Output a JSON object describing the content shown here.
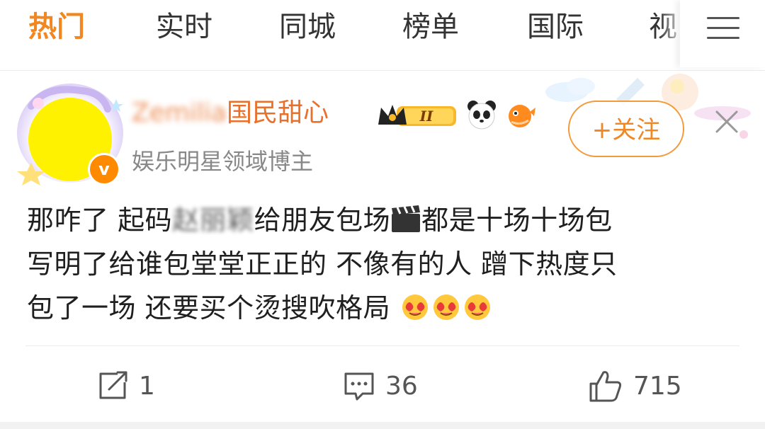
{
  "tabs": [
    {
      "label": "热门",
      "active": true
    },
    {
      "label": "实时",
      "active": false
    },
    {
      "label": "同城",
      "active": false
    },
    {
      "label": "榜单",
      "active": false
    },
    {
      "label": "国际",
      "active": false
    },
    {
      "label": "视",
      "active": false
    }
  ],
  "post": {
    "user": {
      "name_blurred": "Zemilia",
      "name": "国民甜心",
      "badge_level": "II",
      "description": "娱乐明星领域博主",
      "verified_mark": "v"
    },
    "follow_label": "+关注",
    "content_lines": [
      {
        "before": "那咋了 起码",
        "blurred": "赵丽颖",
        "after": "给朋友包场",
        "after2": "都是十场十场包"
      },
      {
        "text": "写明了给谁包堂堂正正的 不像有的人 蹭下热度只"
      },
      {
        "text": "包了一场 还要买个烫搜吹格局"
      }
    ],
    "actions": {
      "repost": "1",
      "comment": "36",
      "like": "715"
    }
  },
  "colors": {
    "accent": "#f08722",
    "username": "#e8702a",
    "muted": "#888888"
  },
  "icons": [
    "menu-icon",
    "verified-icon",
    "crown-rank-badge",
    "panda-icon",
    "pufferfish-icon",
    "close-icon",
    "clapper-icon",
    "heart-eyes-emoji",
    "repost-icon",
    "comment-icon",
    "like-icon"
  ]
}
